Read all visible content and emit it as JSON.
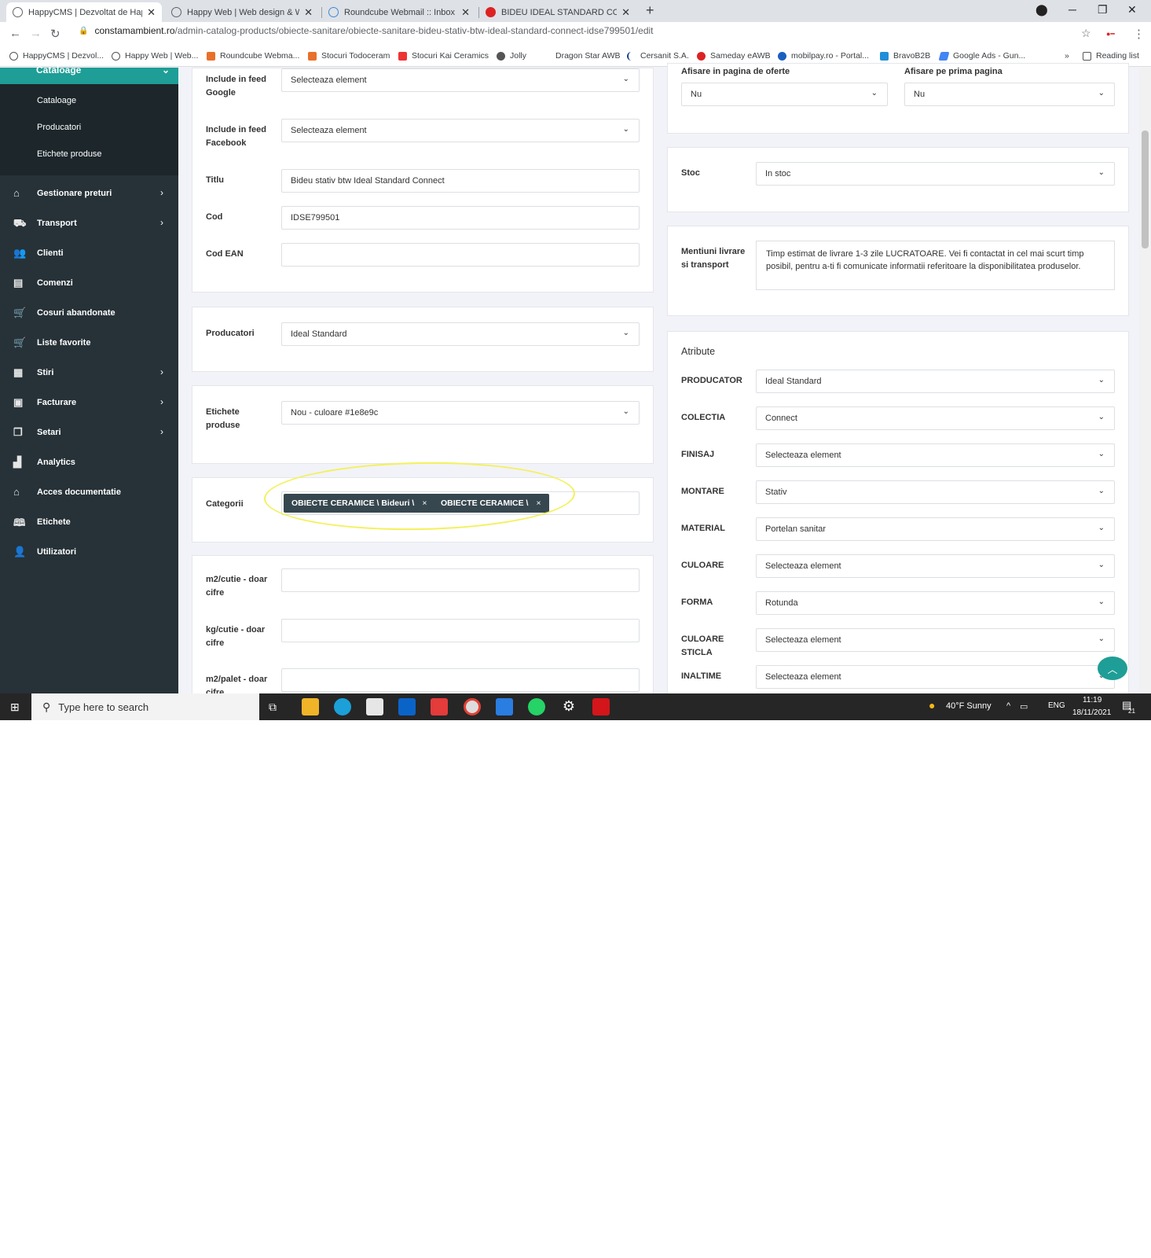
{
  "browser": {
    "tabs": [
      {
        "title": "HappyCMS | Dezvoltat de Happy",
        "active": true
      },
      {
        "title": "Happy Web | Web design & Web"
      },
      {
        "title": "Roundcube Webmail :: Inbox"
      },
      {
        "title": "BIDEU IDEAL STANDARD CONNE"
      }
    ],
    "url_domain": "constamambient.ro",
    "url_path": "/admin-catalog-products/obiecte-sanitare/obiecte-sanitare-bideu-stativ-btw-ideal-standard-connect-idse799501/edit",
    "bookmarks": [
      {
        "label": "HappyCMS | Dezvol...",
        "color": "#555"
      },
      {
        "label": "Happy Web | Web...",
        "color": "#555"
      },
      {
        "label": "Roundcube Webma...",
        "color": "#e8702a"
      },
      {
        "label": "Stocuri Todoceram",
        "color": "#e8702a"
      },
      {
        "label": "Stocuri Kai Ceramics",
        "color": "#e33"
      },
      {
        "label": "Jolly",
        "color": "#555"
      },
      {
        "label": "Dragon Star AWB",
        "color": "#fff"
      },
      {
        "label": "Cersanit S.A.",
        "color": "#1a3e8c"
      },
      {
        "label": "Sameday eAWB",
        "color": "#d22"
      },
      {
        "label": "mobilpay.ro - Portal...",
        "color": "#1a5fc0"
      },
      {
        "label": "BravoB2B",
        "color": "#1f8ed8"
      },
      {
        "label": "Google Ads - Gun...",
        "color": "#4285f4"
      }
    ],
    "more": "»",
    "reading_list": "Reading list"
  },
  "sidebar": {
    "header": "Cataloage",
    "subitems": [
      "Cataloage",
      "Producatori",
      "Etichete produse"
    ],
    "items": [
      {
        "label": "Gestionare preturi",
        "icon": "tag-icon",
        "glyph": "⌂",
        "chevron": true
      },
      {
        "label": "Transport",
        "icon": "truck-icon",
        "glyph": "⛟",
        "chevron": true
      },
      {
        "label": "Clienti",
        "icon": "users-icon",
        "glyph": "👥",
        "chevron": false
      },
      {
        "label": "Comenzi",
        "icon": "orders-icon",
        "glyph": "▤",
        "chevron": false
      },
      {
        "label": "Cosuri abandonate",
        "icon": "cart-icon",
        "glyph": "🛒",
        "chevron": false
      },
      {
        "label": "Liste favorite",
        "icon": "cart-plus-icon",
        "glyph": "🛒",
        "chevron": false
      },
      {
        "label": "Stiri",
        "icon": "news-icon",
        "glyph": "▦",
        "chevron": true
      },
      {
        "label": "Facturare",
        "icon": "invoice-icon",
        "glyph": "▣",
        "chevron": true
      },
      {
        "label": "Setari",
        "icon": "settings-icon",
        "glyph": "❐",
        "chevron": true
      },
      {
        "label": "Analytics",
        "icon": "chart-icon",
        "glyph": "▟",
        "chevron": false
      },
      {
        "label": "Acces documentatie",
        "icon": "home-icon",
        "glyph": "⌂",
        "chevron": false
      },
      {
        "label": "Etichete",
        "icon": "book-icon",
        "glyph": "🕮",
        "chevron": false
      },
      {
        "label": "Utilizatori",
        "icon": "user-icon",
        "glyph": "👤",
        "chevron": false
      }
    ]
  },
  "left_form": {
    "feed_google_label": "Include in feed Google",
    "feed_google_value": "Selecteaza element",
    "feed_facebook_label": "Include in feed Facebook",
    "feed_facebook_value": "Selecteaza element",
    "titlu_label": "Titlu",
    "titlu_value": "Bideu stativ btw Ideal Standard Connect",
    "cod_label": "Cod",
    "cod_value": "IDSE799501",
    "ean_label": "Cod EAN",
    "ean_value": "",
    "producatori_label": "Producatori",
    "producatori_value": "Ideal Standard",
    "etichete_label": "Etichete produse",
    "etichete_value": "Nou - culoare #1e8e9c",
    "categorii_label": "Categorii",
    "categorii_tags": [
      "OBIECTE CERAMICE \\ Bideuri \\",
      "OBIECTE CERAMICE \\"
    ],
    "m2_label": "m2/cutie - doar cifre",
    "kg_label": "kg/cutie - doar cifre",
    "m2palet_label": "m2/palet - doar cifre"
  },
  "right_form": {
    "oferte_label": "Afisare in pagina de oferte",
    "oferte_value": "Nu",
    "prima_label": "Afisare pe prima pagina",
    "prima_value": "Nu",
    "stoc_label": "Stoc",
    "stoc_value": "In stoc",
    "mentiuni_label": "Mentiuni livrare si transport",
    "mentiuni_value": "Timp estimat de livrare 1-3 zile LUCRATOARE. Vei fi contactat in cel mai scurt timp posibil, pentru a-ti fi comunicate informatii referitoare la disponibilitatea produselor.",
    "atribute_title": "Atribute",
    "attributes": [
      {
        "label": "PRODUCATOR",
        "value": "Ideal Standard"
      },
      {
        "label": "COLECTIA",
        "value": "Connect"
      },
      {
        "label": "FINISAJ",
        "value": "Selecteaza element"
      },
      {
        "label": "MONTARE",
        "value": "Stativ"
      },
      {
        "label": "MATERIAL",
        "value": "Portelan sanitar"
      },
      {
        "label": "CULOARE",
        "value": "Selecteaza element"
      },
      {
        "label": "FORMA",
        "value": "Rotunda"
      },
      {
        "label": "CULOARE STICLA",
        "value": "Selecteaza element"
      },
      {
        "label": "INALTIME",
        "value": "Selecteaza element"
      }
    ]
  },
  "taskbar": {
    "search_placeholder": "Type here to search",
    "weather": "40°F  Sunny",
    "lang": "ENG",
    "time": "11:19",
    "date": "18/11/2021",
    "notifications": "21"
  },
  "colors": {
    "accent": "#1e9e96",
    "sidebar": "#263238",
    "tag": "#37474f",
    "highlight": "#f3f15a"
  }
}
